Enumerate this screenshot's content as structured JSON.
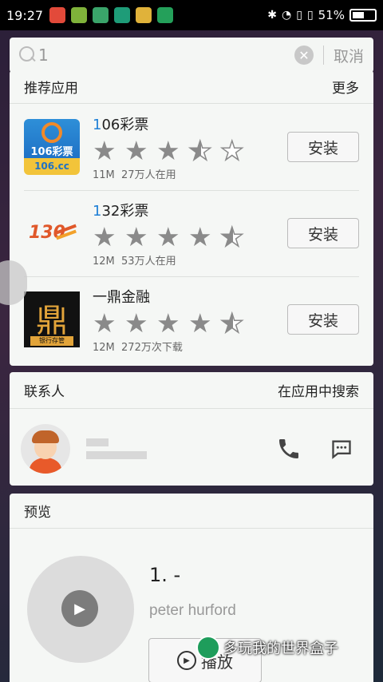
{
  "status_bar": {
    "time": "19:27",
    "battery": "51%"
  },
  "search": {
    "query": "1",
    "cancel_label": "取消"
  },
  "apps_section": {
    "title": "推荐应用",
    "more_label": "更多",
    "apps": [
      {
        "highlight": "1",
        "name_rest": "06彩票",
        "rating": 3.5,
        "size": "11M",
        "users": "27万人在用",
        "install_label": "安装"
      },
      {
        "highlight": "1",
        "name_rest": "32彩票",
        "rating": 4.5,
        "size": "12M",
        "users": "53万人在用",
        "install_label": "安装"
      },
      {
        "highlight": "",
        "name_rest": "一鼎金融",
        "rating": 4.5,
        "size": "12M",
        "users": "272万次下载",
        "install_label": "安装"
      }
    ],
    "icon_texts": {
      "app1_big": "106彩票",
      "app1_small": "106.cc",
      "app2_logo": "130",
      "app3_glyph": "鼎",
      "app3_tag": "银行存管"
    }
  },
  "contacts_section": {
    "title": "联系人",
    "search_in_app_label": "在应用中搜索"
  },
  "preview_section": {
    "title": "预览",
    "track_title": "1. -",
    "artist": "peter hurford",
    "play_label": "播放"
  },
  "watermark": {
    "text": "多玩我的世界盒子"
  },
  "colors": {
    "accent": "#1e7fd6",
    "star": "#8a8a8a",
    "card_bg": "#f5f7f5"
  }
}
